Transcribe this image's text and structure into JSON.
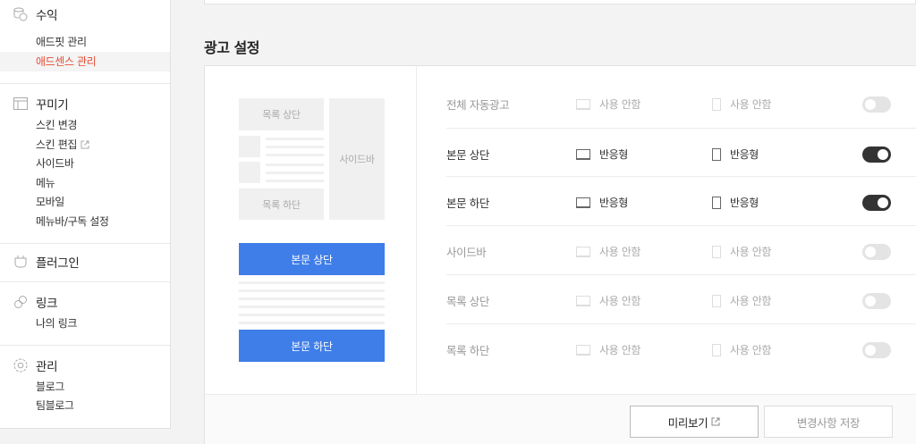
{
  "sidebar": {
    "revenue": {
      "label": "수익",
      "icon": "coins-icon",
      "items": [
        "애드핏 관리",
        "애드센스 관리"
      ]
    },
    "decorate": {
      "label": "꾸미기",
      "icon": "layout-icon",
      "items": [
        "스킨 변경",
        "스킨 편집",
        "사이드바",
        "메뉴",
        "모바일",
        "메뉴바/구독 설정"
      ]
    },
    "plugin": {
      "label": "플러그인",
      "icon": "plug-icon"
    },
    "link": {
      "label": "링크",
      "icon": "link-icon",
      "items": [
        "나의 링크"
      ]
    },
    "manage": {
      "label": "관리",
      "icon": "gear-icon",
      "items": [
        "블로그",
        "팀블로그"
      ]
    }
  },
  "page": {
    "title": "광고 설정"
  },
  "preview": {
    "list_top": "목록 상단",
    "list_bottom": "목록 하단",
    "sidebar": "사이드바",
    "body_top": "본문 상단",
    "body_bottom": "본문 하단"
  },
  "settings": [
    {
      "name": "전체 자동광고",
      "pc": "사용 안함",
      "mobile": "사용 안함",
      "enabled": false
    },
    {
      "name": "본문 상단",
      "pc": "반응형",
      "mobile": "반응형",
      "enabled": true
    },
    {
      "name": "본문 하단",
      "pc": "반응형",
      "mobile": "반응형",
      "enabled": true
    },
    {
      "name": "사이드바",
      "pc": "사용 안함",
      "mobile": "사용 안함",
      "enabled": false
    },
    {
      "name": "목록 상단",
      "pc": "사용 안함",
      "mobile": "사용 안함",
      "enabled": false
    },
    {
      "name": "목록 하단",
      "pc": "사용 안함",
      "mobile": "사용 안함",
      "enabled": false
    }
  ],
  "footer": {
    "preview_label": "미리보기",
    "save_label": "변경사항 저장"
  },
  "colors": {
    "accent": "#e64d35",
    "button_blue": "#3f7ee8",
    "toggle_on": "#333333"
  }
}
